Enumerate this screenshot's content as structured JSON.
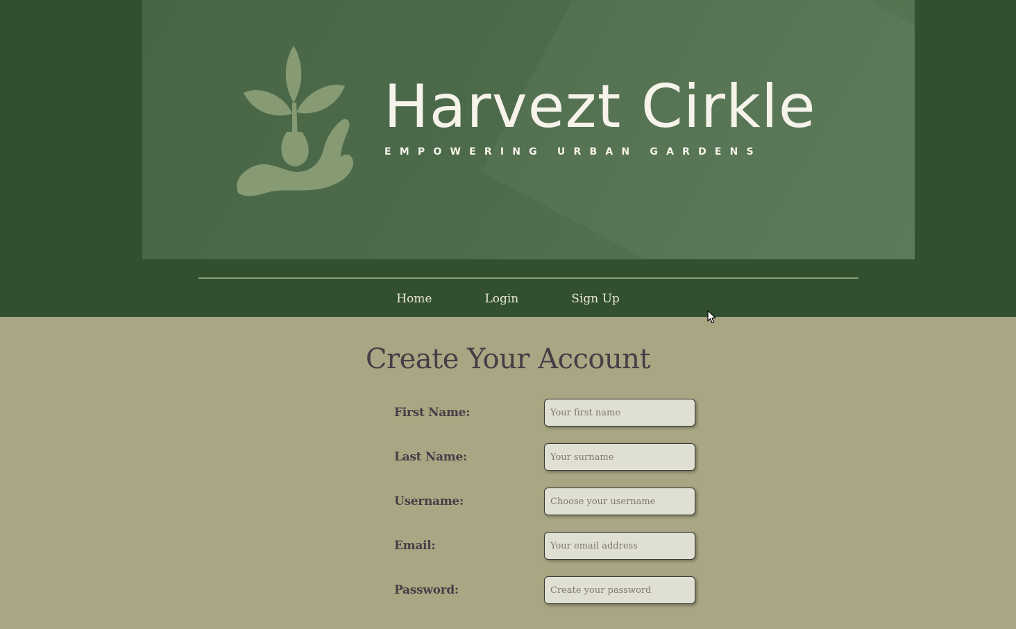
{
  "brand": {
    "name": "Harvezt Cirkle",
    "tagline": "EMPOWERING URBAN GARDENS",
    "logo_icon": "plant-in-hand-icon"
  },
  "nav": {
    "items": [
      {
        "label": "Home"
      },
      {
        "label": "Login"
      },
      {
        "label": "Sign Up"
      }
    ]
  },
  "page": {
    "title": "Create Your Account"
  },
  "form": {
    "fields": [
      {
        "label": "First Name:",
        "placeholder": "Your first name",
        "value": ""
      },
      {
        "label": "Last Name:",
        "placeholder": "Your surname",
        "value": ""
      },
      {
        "label": "Username:",
        "placeholder": "Choose your username",
        "value": ""
      },
      {
        "label": "Email:",
        "placeholder": "Your email address",
        "value": ""
      },
      {
        "label": "Password:",
        "placeholder": "Create your password",
        "value": ""
      }
    ]
  },
  "colors": {
    "header_background": "#325030",
    "banner_background": "#4d6b4b",
    "page_background": "#a9a783",
    "text_dark": "#473d47",
    "nav_text": "#ece8db",
    "input_background": "#e0dfd3"
  }
}
